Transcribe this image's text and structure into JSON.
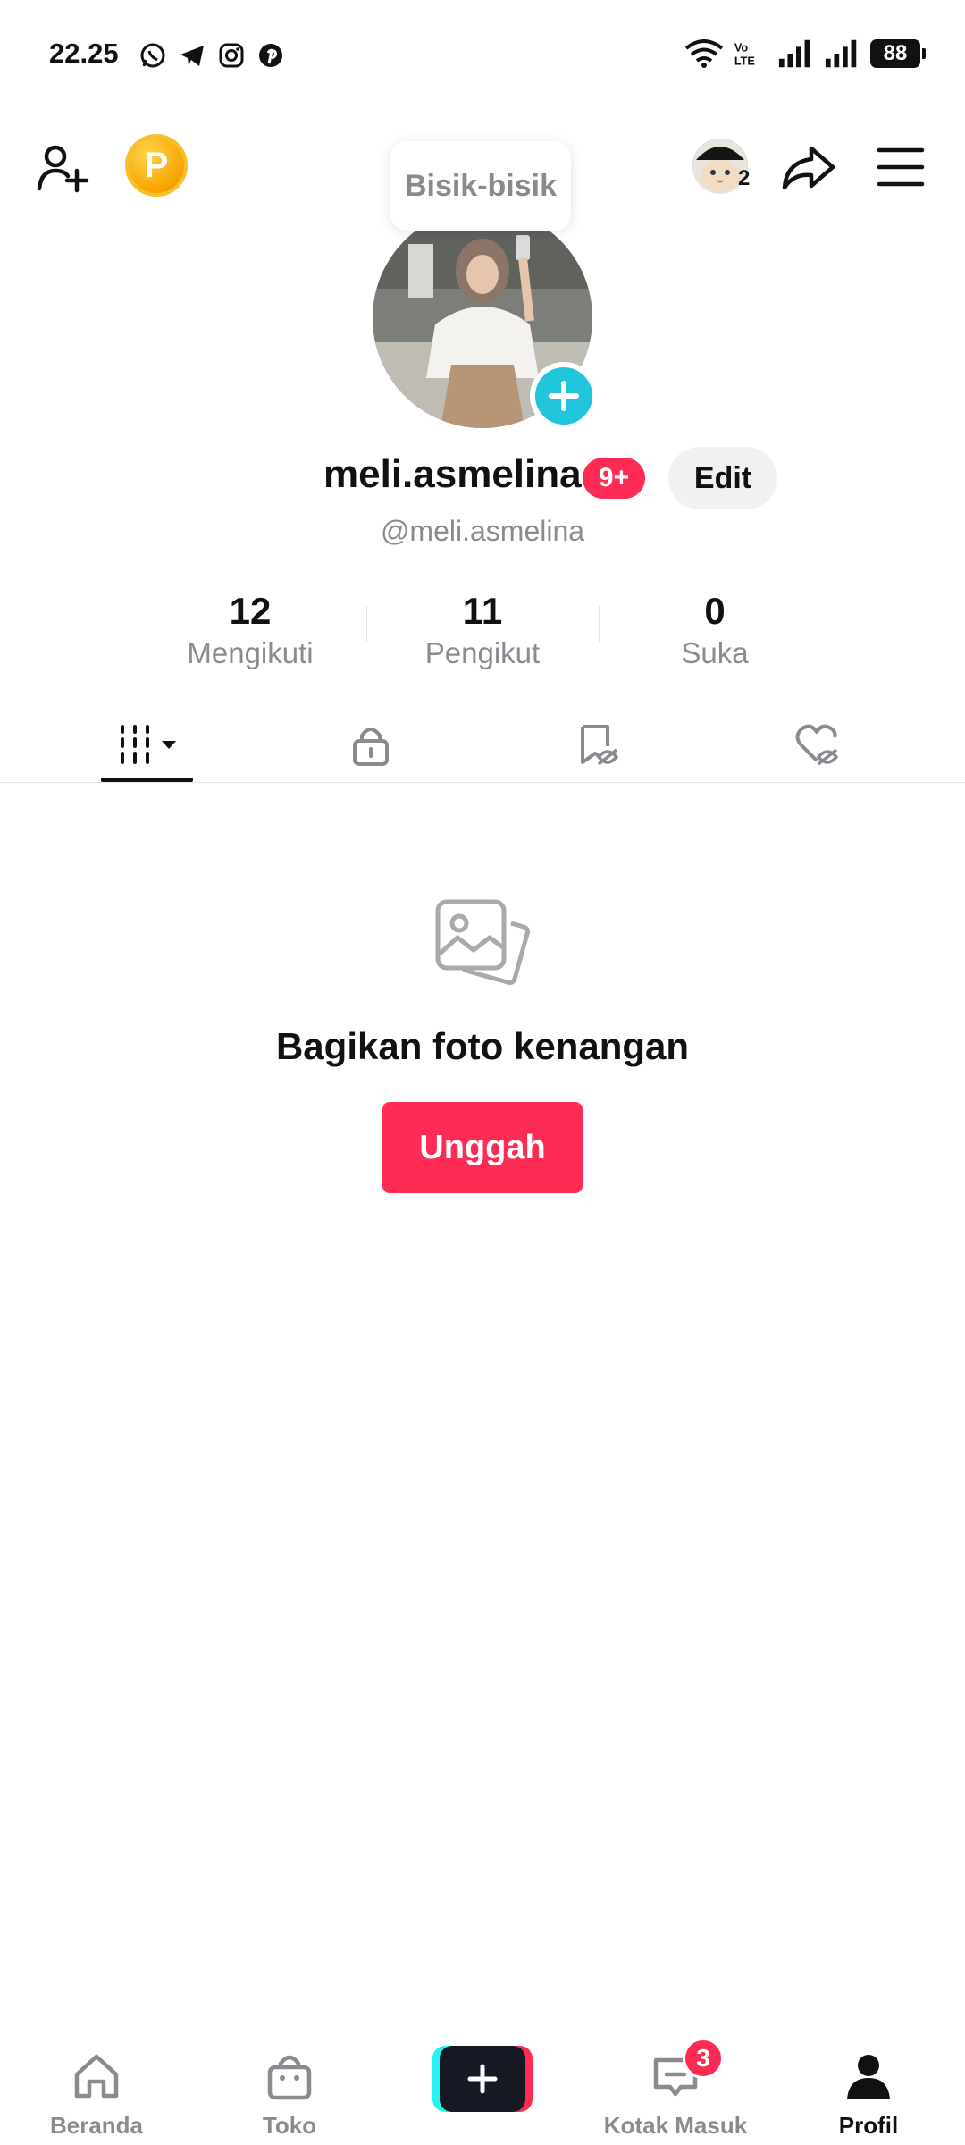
{
  "status_bar": {
    "time": "22.25",
    "app_icons": [
      "whatsapp-icon",
      "telegram-icon",
      "instagram-icon",
      "pinterest-icon"
    ],
    "network_label": "Vo LTE",
    "battery": "88"
  },
  "header": {
    "coin_label": "P",
    "friend_count": "2",
    "bubble_text": "Bisik-bisik"
  },
  "profile": {
    "display_name": "meli.asmelina",
    "notification_badge": "9+",
    "edit_label": "Edit",
    "handle": "@meli.asmelina"
  },
  "stats": [
    {
      "value": "12",
      "label": "Mengikuti"
    },
    {
      "value": "11",
      "label": "Pengikut"
    },
    {
      "value": "0",
      "label": "Suka"
    }
  ],
  "tabs": [
    "videos-grid-icon",
    "lock-icon",
    "bookmark-hidden-icon",
    "liked-hidden-icon"
  ],
  "empty_state": {
    "title": "Bagikan foto kenangan",
    "button": "Unggah"
  },
  "bottom_nav": {
    "items": [
      {
        "label": "Beranda",
        "icon": "home-icon"
      },
      {
        "label": "Toko",
        "icon": "shop-bag-icon"
      },
      {
        "label": "",
        "icon": "create-plus-icon"
      },
      {
        "label": "Kotak Masuk",
        "icon": "inbox-icon"
      },
      {
        "label": "Profil",
        "icon": "profile-icon"
      }
    ],
    "inbox_badge": "3",
    "active": "Profil"
  },
  "colors": {
    "accent": "#fe2c55",
    "cyan": "#20c5dc",
    "text_secondary": "#8a8b91"
  }
}
